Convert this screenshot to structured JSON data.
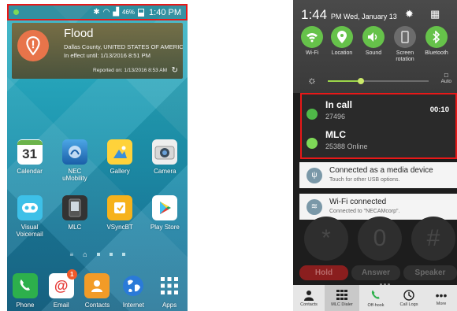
{
  "left_phone": {
    "status_bar": {
      "battery": "46%",
      "time": "1:40 PM"
    },
    "weather_widget": {
      "title": "Flood",
      "location": "Dallas County, UNITED STATES OF AMERICA",
      "effective": "In effect until: 1/13/2016 8:51 PM",
      "reported": "Reported on: 1/13/2016 8:53 AM"
    },
    "apps_row1": [
      {
        "label": "Calendar",
        "icon": "calendar-icon",
        "cal_day": "31"
      },
      {
        "label": "NEC uMobility",
        "icon": "nec-umobility-icon"
      },
      {
        "label": "Gallery",
        "icon": "gallery-icon"
      },
      {
        "label": "Camera",
        "icon": "camera-icon"
      }
    ],
    "apps_row2": [
      {
        "label": "Visual Voicemail",
        "icon": "voicemail-icon"
      },
      {
        "label": "MLC",
        "icon": "mlc-icon"
      },
      {
        "label": "VSyncBT",
        "icon": "vsync-icon"
      },
      {
        "label": "Play Store",
        "icon": "play-store-icon"
      }
    ],
    "dock": [
      {
        "label": "Phone",
        "icon": "phone-icon"
      },
      {
        "label": "Email",
        "icon": "email-icon",
        "badge": "1"
      },
      {
        "label": "Contacts",
        "icon": "contacts-icon"
      },
      {
        "label": "Internet",
        "icon": "internet-icon"
      },
      {
        "label": "Apps",
        "icon": "apps-grid-icon"
      }
    ]
  },
  "right_phone": {
    "time": "1:44",
    "ampm_date": "PM Wed, January 13",
    "quick_toggles": [
      {
        "label": "Wi-Fi",
        "on": true
      },
      {
        "label": "Location",
        "on": true
      },
      {
        "label": "Sound",
        "on": true
      },
      {
        "label": "Screen rotation",
        "on": false
      },
      {
        "label": "Bluetooth",
        "on": true
      }
    ],
    "brightness": {
      "level_fraction": 0.33,
      "auto_label": "Auto"
    },
    "notifications": {
      "call": {
        "title": "In call",
        "number": "27496",
        "timer": "00:10"
      },
      "mlc": {
        "title": "MLC",
        "status": "25388 Online"
      }
    },
    "cards": [
      {
        "title": "Connected as a media device",
        "subtitle": "Touch for other USB options.",
        "icon": "usb-icon"
      },
      {
        "title": "Wi-Fi connected",
        "subtitle": "Connected to \"NECAMcorp\".",
        "icon": "wifi-icon"
      }
    ],
    "dialpad_keys": [
      "*",
      "0",
      "#"
    ],
    "call_buttons": [
      "Hold",
      "Answer",
      "Speaker"
    ],
    "tabs": [
      {
        "label": "Contacts",
        "icon": "person-icon"
      },
      {
        "label": "MLC Dialer",
        "icon": "dialpad-icon",
        "active": true
      },
      {
        "label": "Off-hook",
        "icon": "handset-icon"
      },
      {
        "label": "Call Logs",
        "icon": "history-icon"
      },
      {
        "label": "More",
        "icon": "more-icon"
      }
    ],
    "colors": {
      "toggle_on": "#66c24a",
      "highlight": "#e81818"
    }
  }
}
